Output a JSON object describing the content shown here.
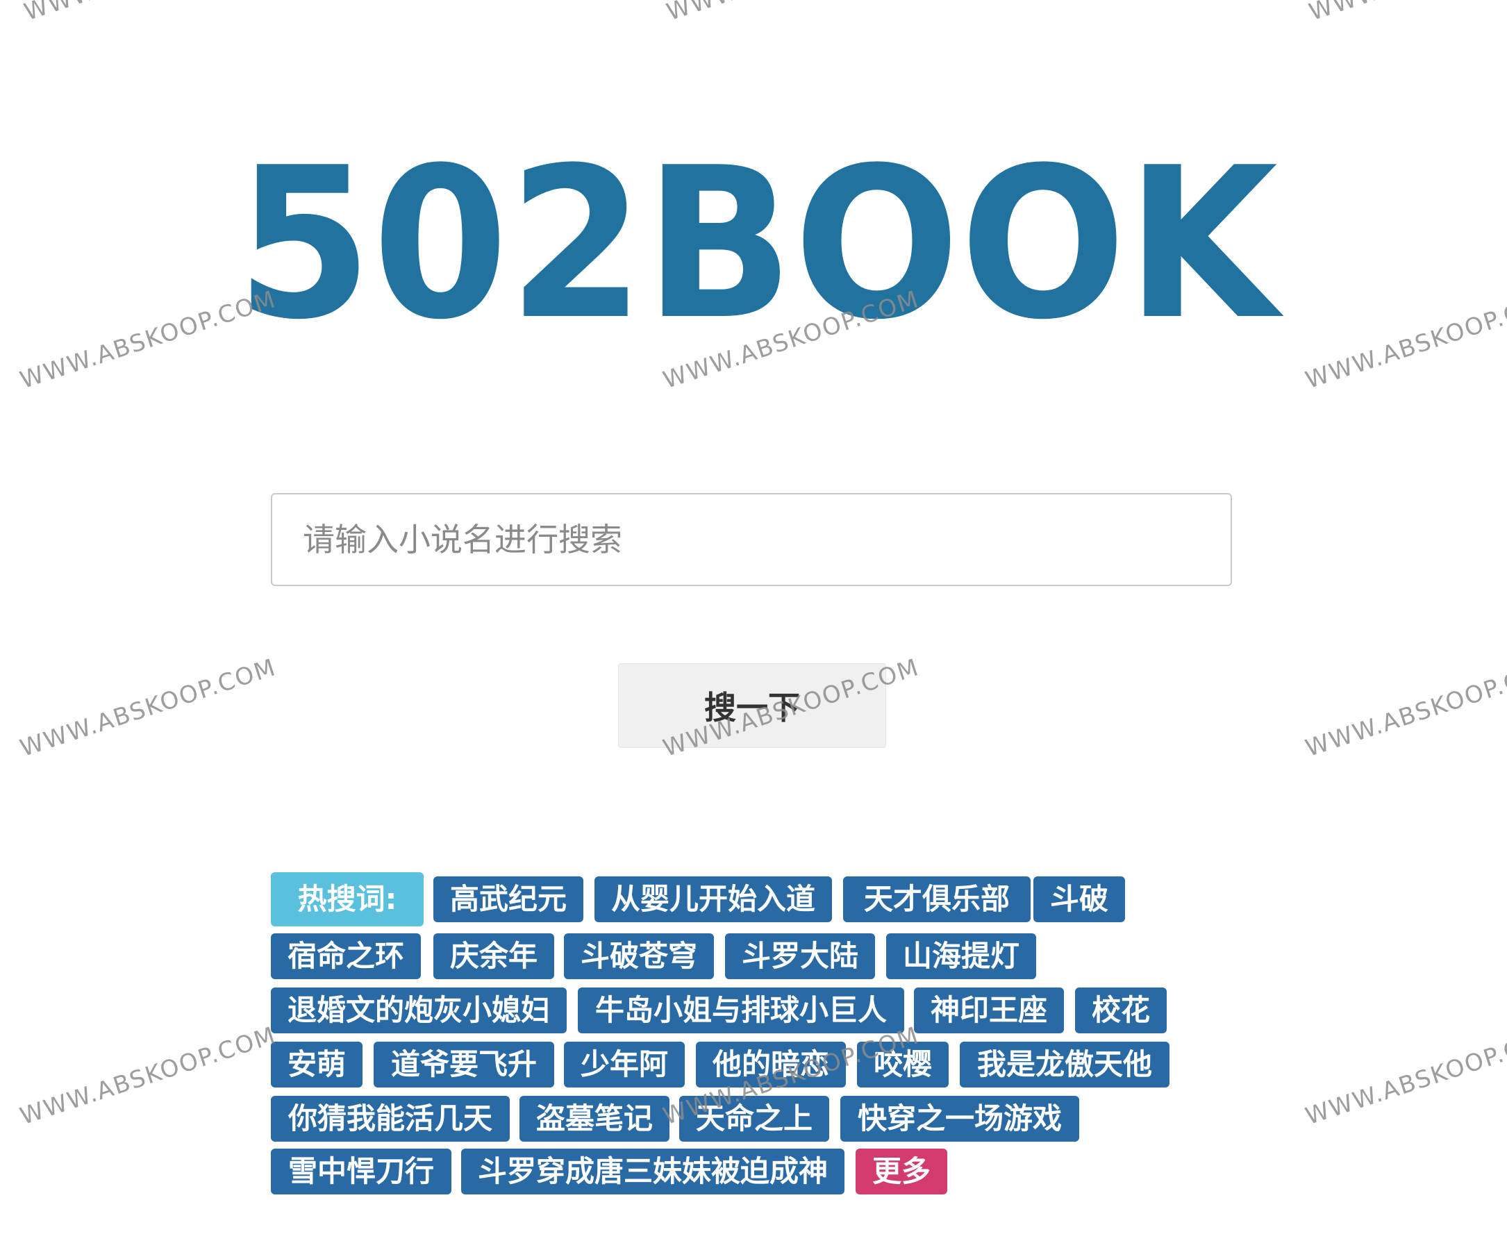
{
  "logo": {
    "text": "502BOOK",
    "color": "#21729f"
  },
  "search": {
    "placeholder": "请输入小说名进行搜索",
    "value": ""
  },
  "search_button": {
    "label": "搜一下"
  },
  "hot": {
    "label": "热搜词:",
    "label_color": "#5bc0de",
    "tag_color": "#2a6aa4",
    "more_color": "#d13b6e",
    "tags": [
      "高武纪元",
      "从婴儿开始入道",
      "天才俱乐部",
      "斗破",
      "宿命之环",
      "庆余年",
      "斗破苍穹",
      "斗罗大陆",
      "山海提灯",
      "退婚文的炮灰小媳妇",
      "牛岛小姐与排球小巨人",
      "神印王座",
      "校花",
      "安萌",
      "道爷要飞升",
      "少年阿",
      "他的暗恋",
      "咬樱",
      "我是龙傲天他",
      "你猜我能活几天",
      "盗墓笔记",
      "天命之上",
      "快穿之一场游戏",
      "雪中悍刀行",
      "斗罗穿成唐三妹妹被迫成神"
    ],
    "more": "更多"
  },
  "watermark": {
    "text": "WWW.ABSKOOP.COM"
  }
}
